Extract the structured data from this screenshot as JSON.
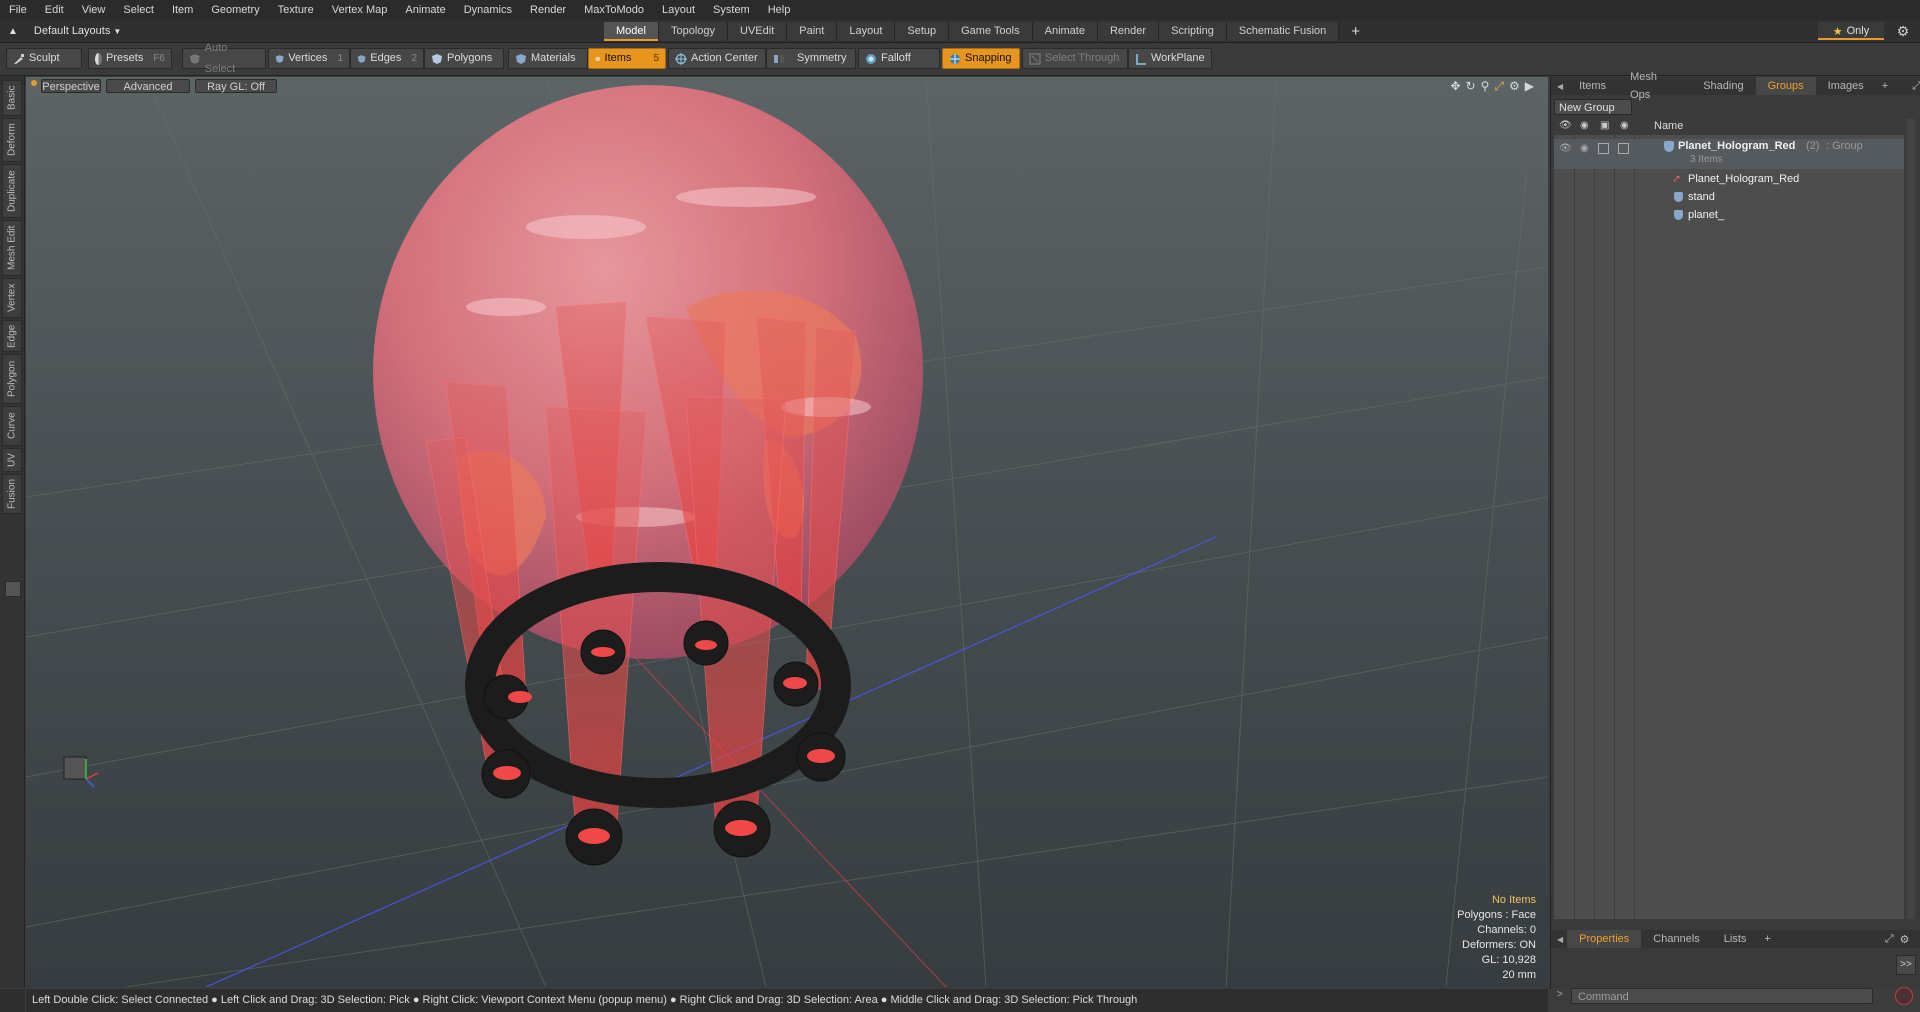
{
  "menu": [
    "File",
    "Edit",
    "View",
    "Select",
    "Item",
    "Geometry",
    "Texture",
    "Vertex Map",
    "Animate",
    "Dynamics",
    "Render",
    "MaxToModo",
    "Layout",
    "System",
    "Help"
  ],
  "layout_selector": "Default Layouts",
  "mode_tabs": [
    {
      "label": "Model",
      "active": true
    },
    {
      "label": "Topology",
      "active": false
    },
    {
      "label": "UVEdit",
      "active": false
    },
    {
      "label": "Paint",
      "active": false
    },
    {
      "label": "Layout",
      "active": false
    },
    {
      "label": "Setup",
      "active": false
    },
    {
      "label": "Game Tools",
      "active": false
    },
    {
      "label": "Animate",
      "active": false
    },
    {
      "label": "Render",
      "active": false
    },
    {
      "label": "Scripting",
      "active": false
    },
    {
      "label": "Schematic Fusion",
      "active": false
    }
  ],
  "only_label": "Only",
  "toolbar": {
    "sculpt": "Sculpt",
    "presets": "Presets",
    "presets_key": "F6",
    "auto_select": "Auto Select",
    "vertices": "Vertices",
    "vertices_key": "1",
    "edges": "Edges",
    "edges_key": "2",
    "polygons": "Polygons",
    "materials": "Materials",
    "items": "Items",
    "items_key": "5",
    "action_center": "Action Center",
    "symmetry": "Symmetry",
    "falloff": "Falloff",
    "snapping": "Snapping",
    "select_through": "Select Through",
    "workplane": "WorkPlane"
  },
  "left_tabs": [
    "Basic",
    "Deform",
    "Duplicate",
    "Mesh Edit",
    "Vertex",
    "Edge",
    "Polygon",
    "Curve",
    "UV",
    "Fusion"
  ],
  "viewport": {
    "view": "Perspective",
    "shading": "Advanced",
    "raygl": "Ray GL: Off",
    "info": {
      "items": "No Items",
      "polygons": "Polygons : Face",
      "channels": "Channels: 0",
      "deformers": "Deformers: ON",
      "gl": "GL: 10,928",
      "scale": "20 mm"
    }
  },
  "right_panel": {
    "tabs": [
      {
        "label": "Items",
        "active": false
      },
      {
        "label": "Mesh Ops",
        "active": false
      },
      {
        "label": "Shading",
        "active": false
      },
      {
        "label": "Groups",
        "active": true
      },
      {
        "label": "Images",
        "active": false
      }
    ],
    "new_group": "New Group",
    "name_header": "Name",
    "group": {
      "name": "Planet_Hologram_Red",
      "count": "(2)",
      "type": ": Group",
      "items_count": "3 Items"
    },
    "children": [
      "Planet_Hologram_Red",
      "stand",
      "planet_"
    ],
    "bottom_tabs": [
      {
        "label": "Properties",
        "active": true
      },
      {
        "label": "Channels",
        "active": false
      },
      {
        "label": "Lists",
        "active": false
      }
    ],
    "command_placeholder": "Command"
  },
  "status_bar": "Left Double Click: Select Connected ● Left Click and Drag: 3D Selection: Pick ● Right Click: Viewport Context Menu (popup menu) ● Right Click and Drag: 3D Selection: Area ● Middle Click and Drag: 3D Selection: Pick Through",
  "colors": {
    "accent": "#e8951e",
    "hologram": "#e05a5a",
    "bg": "#3a3a3a"
  }
}
